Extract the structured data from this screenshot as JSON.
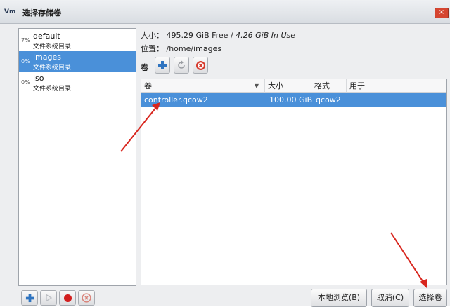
{
  "window": {
    "title": "选择存储卷",
    "app_icon": "virt-manager-icon",
    "close_label": "×"
  },
  "pools": [
    {
      "percent": "7%",
      "name": "default",
      "type": "文件系统目录",
      "selected": false
    },
    {
      "percent": "0%",
      "name": "images",
      "type": "文件系统目录",
      "selected": true
    },
    {
      "percent": "0%",
      "name": "iso",
      "type": "文件系统目录",
      "selected": false
    }
  ],
  "pool_info": {
    "size_label": "大小：",
    "size_free": "495.29 GiB Free /",
    "size_in_use": "4.26 GiB In Use",
    "location_label": "位置：",
    "location_value": "/home/images"
  },
  "volume_toolbar": {
    "label": "卷",
    "add_icon": "plus-icon",
    "refresh_icon": "refresh-icon",
    "delete_icon": "delete-icon"
  },
  "volume_table": {
    "columns": [
      "卷",
      "大小",
      "格式",
      "用于"
    ],
    "rows": [
      {
        "name": "controller.qcow2",
        "size": "100.00 GiB",
        "format": "qcow2",
        "used_by": "",
        "selected": true
      }
    ]
  },
  "bottom_bar": {
    "add_pool_icon": "plus-icon",
    "start_pool_icon": "play-icon",
    "stop_pool_icon": "stop-icon",
    "delete_pool_icon": "delete-icon",
    "browse_local_label": "本地浏览(B)",
    "cancel_label": "取消(C)",
    "choose_volume_label": "选择卷"
  },
  "colors": {
    "selection": "#4a90d9",
    "annotation_arrow": "#d8251d"
  }
}
